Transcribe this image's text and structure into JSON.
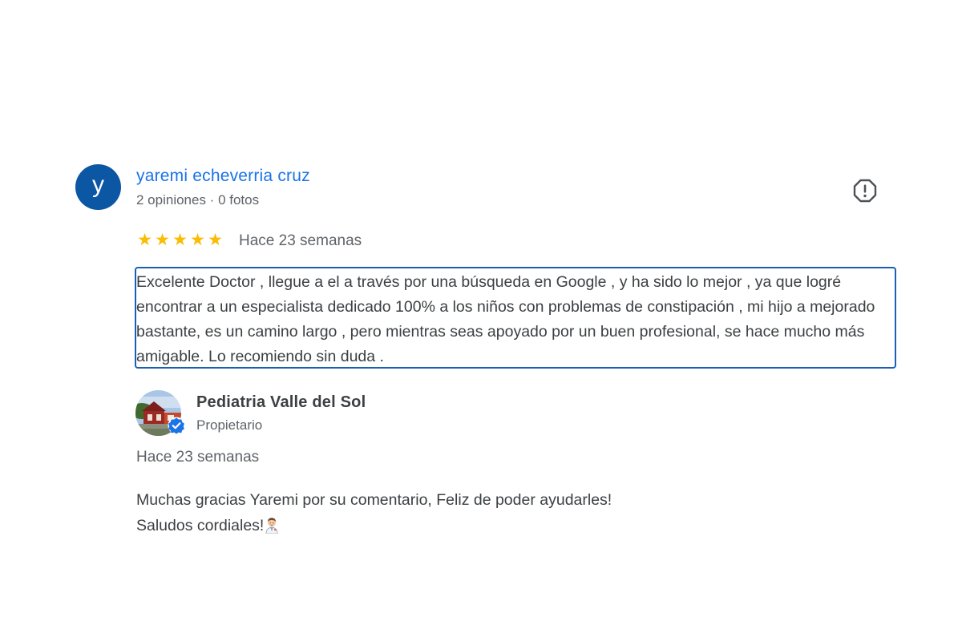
{
  "review": {
    "author_initial": "y",
    "author_name": "yaremi echeverria cruz",
    "author_meta": "2 opiniones · 0 fotos",
    "stars": [
      "★",
      "★",
      "★",
      "★",
      "★"
    ],
    "rating": 5,
    "date": "Hace 23 semanas",
    "text": "Excelente Doctor , llegue a el a través por una búsqueda en Google , y ha sido lo mejor , ya que logré encontrar a un especialista dedicado 100% a los niños con problemas de constipación , mi hijo a mejorado bastante, es un camino largo , pero mientras seas apoyado por un buen profesional, se hace mucho más amigable. Lo recomiendo sin duda ."
  },
  "owner_response": {
    "name": "Pediatria Valle del Sol",
    "role": "Propietario",
    "date": "Hace 23 semanas",
    "reply_line1": "Muchas gracias Yaremi por su comentario, Feliz de poder ayudarles!",
    "reply_line2": "Saludos cordiales!"
  },
  "icons": {
    "report": "report-flag-icon",
    "verified": "verified-check-icon",
    "doctor": "man-health-worker-emoji"
  },
  "colors": {
    "avatar_bg": "#0b57a4",
    "author_link": "#1a73e8",
    "star": "#fbbc04",
    "focus_border": "#1a5fb4",
    "verified": "#1a73e8"
  }
}
